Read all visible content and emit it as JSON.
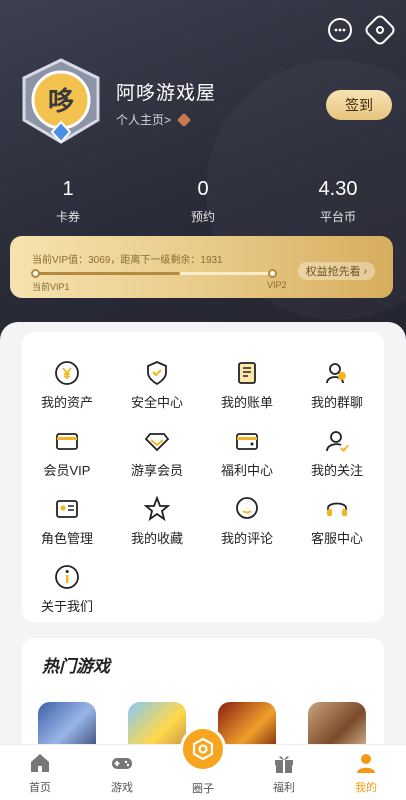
{
  "header": {
    "user_name": "阿哆游戏屋",
    "profile_link": "个人主页>",
    "checkin_label": "签到"
  },
  "stats": [
    {
      "value": "1",
      "label": "卡券"
    },
    {
      "value": "0",
      "label": "预约"
    },
    {
      "value": "4.30",
      "label": "平台币"
    }
  ],
  "vip": {
    "status_text": "当前VIP值：3069，距离下一级剩余：1931",
    "current_level": "当前VIP1",
    "next_level": "VIP2",
    "rights_label": "权益抢先看",
    "progress": 0.61
  },
  "services": [
    {
      "label": "我的资产",
      "icon": "yen-icon"
    },
    {
      "label": "安全中心",
      "icon": "shield-icon"
    },
    {
      "label": "我的账单",
      "icon": "bill-icon"
    },
    {
      "label": "我的群聊",
      "icon": "group-chat-icon"
    },
    {
      "label": "会员VIP",
      "icon": "card-icon"
    },
    {
      "label": "游享会员",
      "icon": "diamond-icon"
    },
    {
      "label": "福利中心",
      "icon": "wallet-icon"
    },
    {
      "label": "我的关注",
      "icon": "follow-icon"
    },
    {
      "label": "角色管理",
      "icon": "role-card-icon"
    },
    {
      "label": "我的收藏",
      "icon": "star-icon"
    },
    {
      "label": "我的评论",
      "icon": "comment-icon"
    },
    {
      "label": "客服中心",
      "icon": "headset-icon"
    },
    {
      "label": "关于我们",
      "icon": "info-icon"
    }
  ],
  "hot_games": {
    "title": "热门游戏"
  },
  "tabs": [
    {
      "label": "首页",
      "icon": "home-icon"
    },
    {
      "label": "游戏",
      "icon": "gamepad-icon"
    },
    {
      "label": "圈子",
      "icon": "circle-icon"
    },
    {
      "label": "福利",
      "icon": "gift-icon"
    },
    {
      "label": "我的",
      "icon": "profile-icon"
    }
  ],
  "colors": {
    "accent": "#f39a14",
    "gold": "#e7c986",
    "hero_dark": "#2a2b38"
  }
}
